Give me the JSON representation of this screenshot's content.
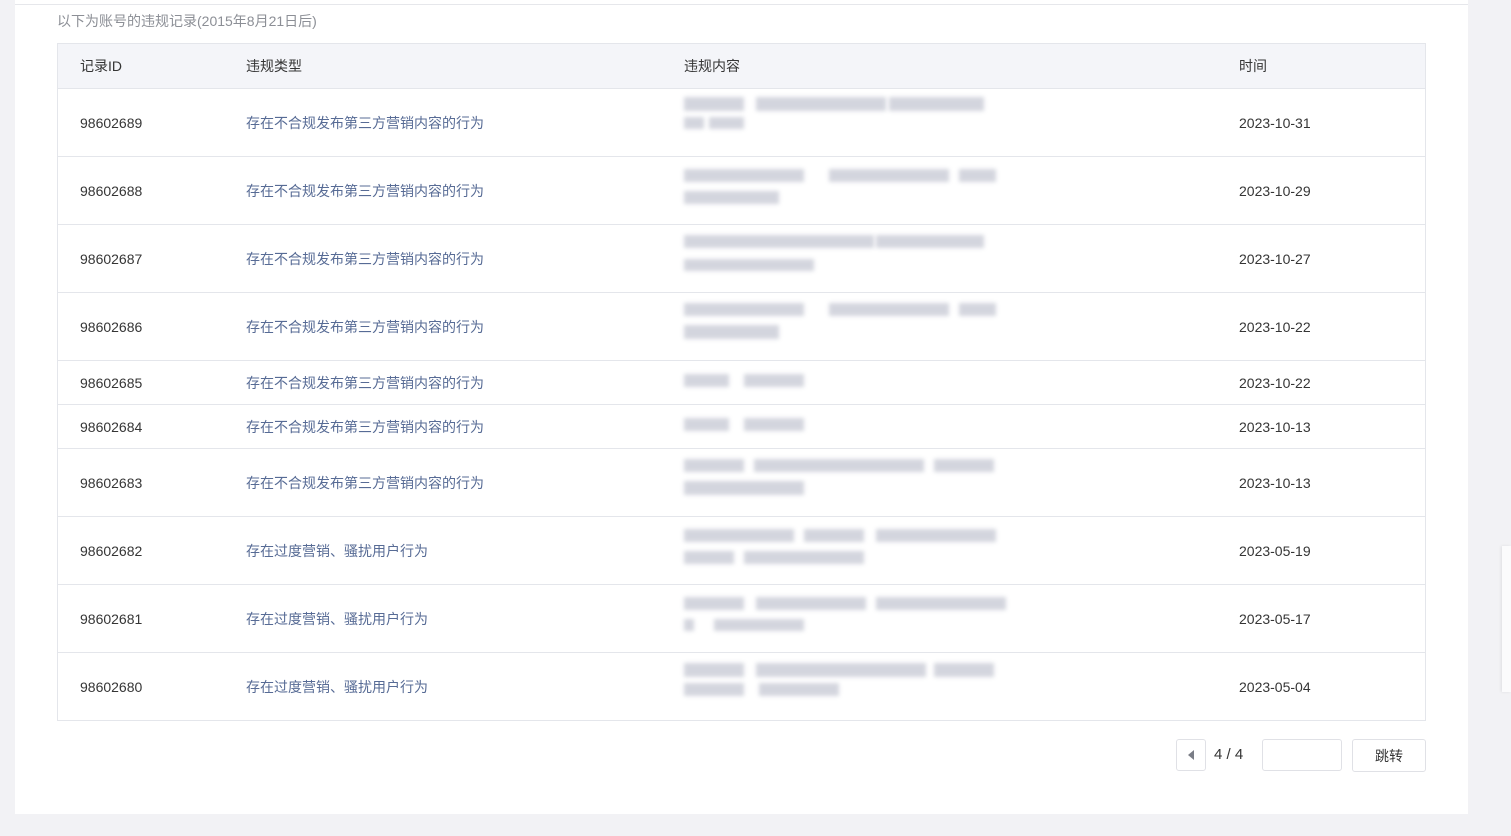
{
  "subtitle": "以下为账号的违规记录(2015年8月21日后)",
  "table": {
    "headers": [
      "记录ID",
      "违规类型",
      "违规内容",
      "时间"
    ],
    "rows": [
      {
        "id": "98602689",
        "type": "存在不合规发布第三方营销内容的行为",
        "time": "2023-10-31",
        "content_redacted": true
      },
      {
        "id": "98602688",
        "type": "存在不合规发布第三方营销内容的行为",
        "time": "2023-10-29",
        "content_redacted": true
      },
      {
        "id": "98602687",
        "type": "存在不合规发布第三方营销内容的行为",
        "time": "2023-10-27",
        "content_redacted": true
      },
      {
        "id": "98602686",
        "type": "存在不合规发布第三方营销内容的行为",
        "time": "2023-10-22",
        "content_redacted": true
      },
      {
        "id": "98602685",
        "type": "存在不合规发布第三方营销内容的行为",
        "time": "2023-10-22",
        "content_redacted": true
      },
      {
        "id": "98602684",
        "type": "存在不合规发布第三方营销内容的行为",
        "time": "2023-10-13",
        "content_redacted": true
      },
      {
        "id": "98602683",
        "type": "存在不合规发布第三方营销内容的行为",
        "time": "2023-10-13",
        "content_redacted": true
      },
      {
        "id": "98602682",
        "type": "存在过度营销、骚扰用户行为",
        "time": "2023-05-19",
        "content_redacted": true
      },
      {
        "id": "98602681",
        "type": "存在过度营销、骚扰用户行为",
        "time": "2023-05-17",
        "content_redacted": true
      },
      {
        "id": "98602680",
        "type": "存在过度营销、骚扰用户行为",
        "time": "2023-05-04",
        "content_redacted": true
      }
    ]
  },
  "pagination": {
    "status": "4 / 4",
    "jump_label": "跳转",
    "prev_icon": "caret-left-icon",
    "page_input_value": ""
  }
}
